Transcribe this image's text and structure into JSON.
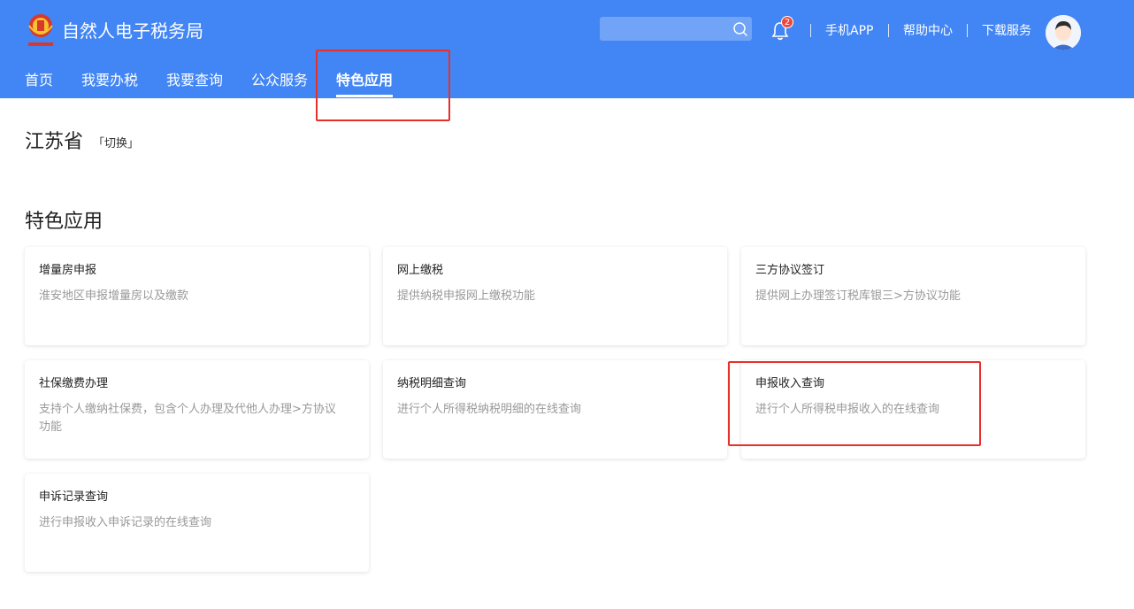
{
  "header": {
    "site_title": "自然人电子税务局",
    "notification_count": "2",
    "links": [
      "手机APP",
      "帮助中心",
      "下载服务"
    ],
    "nav": [
      "首页",
      "我要办税",
      "我要查询",
      "公众服务",
      "特色应用"
    ],
    "active_nav": "特色应用",
    "search": {
      "placeholder": ""
    },
    "colors": {
      "header_bg": "#4285f4",
      "highlight": "#e8302a"
    }
  },
  "province": {
    "name": "江苏省",
    "switch_label": "「切换」"
  },
  "section": {
    "title": "特色应用"
  },
  "cards": [
    {
      "title": "增量房申报",
      "desc": "淮安地区申报增量房以及缴款"
    },
    {
      "title": "网上缴税",
      "desc": "提供纳税申报网上缴税功能"
    },
    {
      "title": "三方协议签订",
      "desc": "提供网上办理签订税库银三>方协议功能"
    },
    {
      "title": "社保缴费办理",
      "desc": "支持个人缴纳社保费，包含个人办理及代他人办理>方协议功能"
    },
    {
      "title": "纳税明细查询",
      "desc": "进行个人所得税纳税明细的在线查询"
    },
    {
      "title": "申报收入查询",
      "desc": "进行个人所得税申报收入的在线查询"
    },
    {
      "title": "申诉记录查询",
      "desc": "进行申报收入申诉记录的在线查询"
    }
  ]
}
